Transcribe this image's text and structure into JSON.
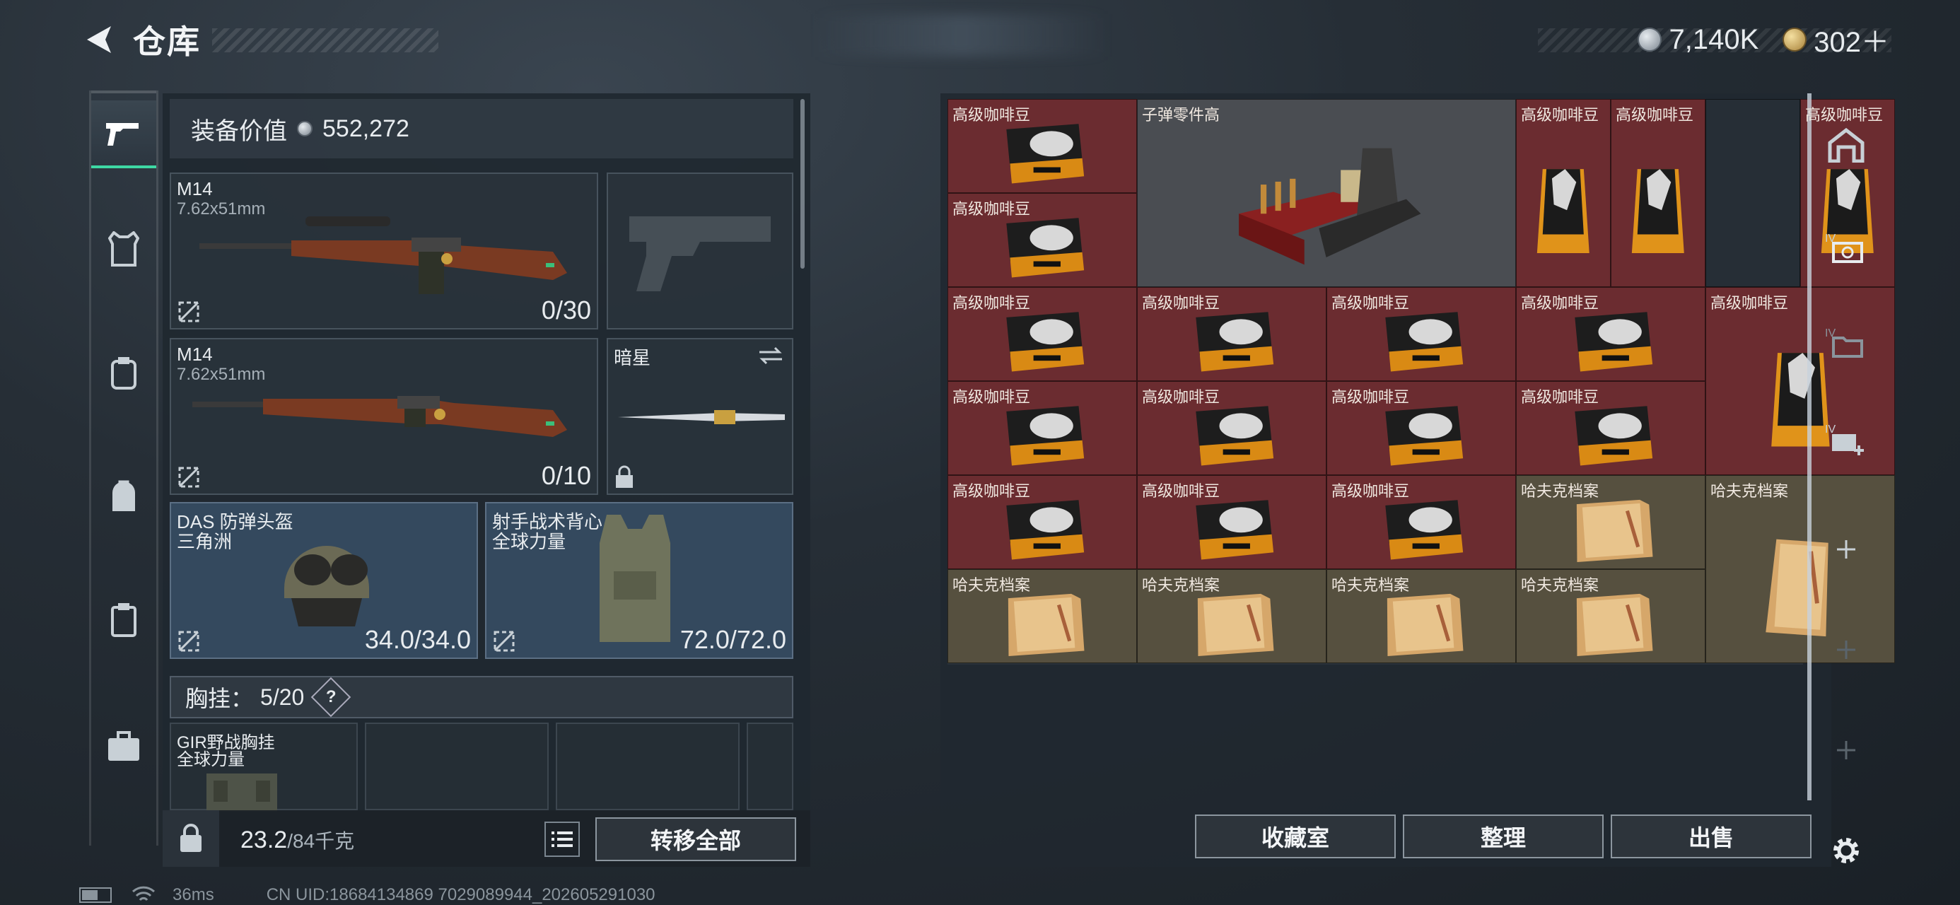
{
  "header": {
    "title": "仓库"
  },
  "currency": [
    {
      "icon": "silver-coin-icon",
      "value": "7,140K"
    },
    {
      "icon": "gold-coin-icon",
      "value": "302＋"
    }
  ],
  "equipment": {
    "value_label": "装备价值",
    "value": "552,272",
    "primary1": {
      "name": "M14",
      "caliber": "7.62x51mm",
      "ammo": "0/30"
    },
    "primary2": {
      "name": "M14",
      "caliber": "7.62x51mm",
      "ammo": "0/10"
    },
    "melee": {
      "name": "暗星"
    },
    "helmet": {
      "name": "DAS 防弹头盔",
      "faction": "三角洲",
      "durability": "34.0/34.0"
    },
    "armor": {
      "name": "射手战术背心",
      "faction": "全球力量",
      "durability": "72.0/72.0"
    },
    "chest_label": "胸挂：",
    "chest_count": "5/20",
    "chest_help": "?",
    "rig": {
      "name": "GIR野战胸挂",
      "faction": "全球力量"
    },
    "weight": "23.2",
    "weight_max": "/84千克",
    "transfer_all": "转移全部"
  },
  "stash": {
    "coffee": "高级咖啡豆",
    "bullet_parts": "子弹零件高",
    "harford": "哈夫克档案"
  },
  "buttons": {
    "collection": "收藏室",
    "organize": "整理",
    "sell": "出售"
  },
  "status": {
    "ping": "36ms",
    "uid": "CN UID:18684134869 7029089944_202605291030"
  }
}
